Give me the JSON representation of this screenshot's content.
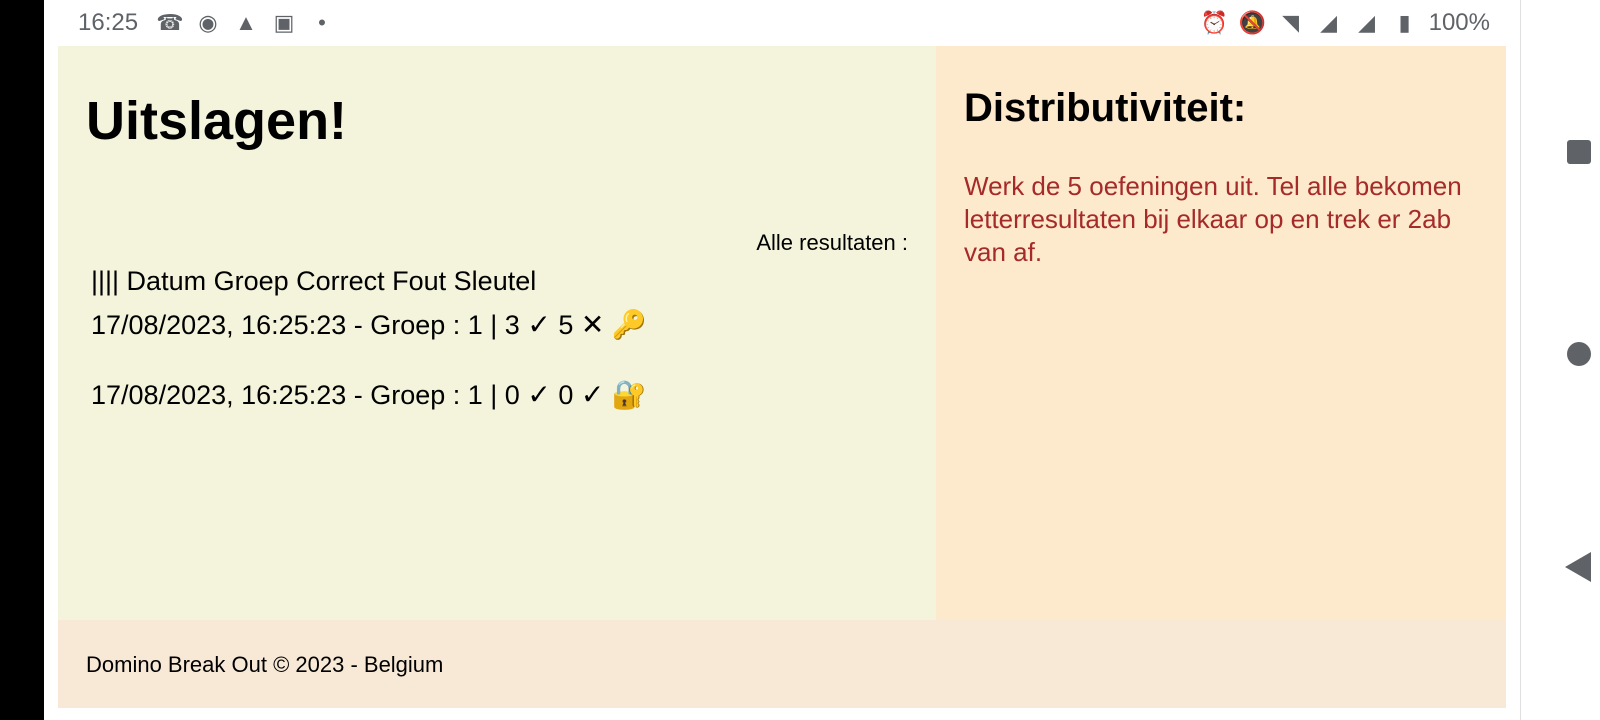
{
  "status_bar": {
    "time": "16:25",
    "battery": "100%",
    "left_icons": {
      "call": "☎",
      "spotify": "◉",
      "warning": "▲",
      "app": "▣",
      "dot": "•"
    },
    "right_icons": {
      "alarm": "⏰",
      "bell_off": "🔕",
      "wifi": "◥",
      "signal_r": "◢",
      "signal": "◢",
      "battery_icon": "▮"
    }
  },
  "main": {
    "title": "Uitslagen!",
    "results_label": "Alle resultaten :",
    "header": "|||| Datum Groep Correct Fout Sleutel",
    "rows": [
      {
        "text": "17/08/2023, 16:25:23 - Groep : 1 | 3",
        "correct_mark": "✓",
        "fout": "5",
        "fout_mark": "✕",
        "key": "🔑"
      },
      {
        "text": "17/08/2023, 16:25:23 - Groep : 1 | 0",
        "correct_mark": "✓",
        "fout": "0",
        "fout_mark": "✓",
        "key": "🔐"
      }
    ]
  },
  "aside": {
    "title": "Distributiviteit:",
    "text": "Werk de 5 oefeningen uit. Tel alle bekomen letterresultaten bij elkaar op en trek er 2ab van af."
  },
  "footer": {
    "text": "Domino Break Out © 2023 - Belgium"
  },
  "colors": {
    "main_bg": "#f4f4dc",
    "aside_bg": "#fde9cc",
    "footer_bg": "#f8e9d6",
    "aside_text": "#a52a2a"
  }
}
